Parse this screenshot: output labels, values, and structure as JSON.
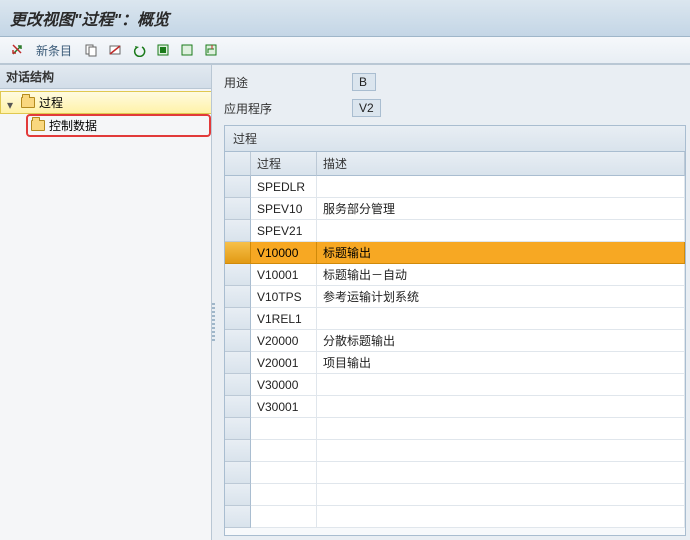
{
  "title": "更改视图\"过程\"：概览",
  "toolbar": {
    "new_entries": "新条目"
  },
  "sidebar": {
    "header": "对话结构",
    "items": [
      {
        "label": "过程",
        "children": [
          {
            "label": "控制数据"
          }
        ]
      }
    ]
  },
  "form": {
    "usage_label": "用途",
    "usage_value": "B",
    "application_label": "应用程序",
    "application_value": "V2"
  },
  "grid": {
    "title": "过程",
    "columns": [
      "过程",
      "描述"
    ],
    "selected_index": 3,
    "empty_rows": 5,
    "rows": [
      {
        "code": "SPEDLR",
        "desc": ""
      },
      {
        "code": "SPEV10",
        "desc": "服务部分管理"
      },
      {
        "code": "SPEV21",
        "desc": ""
      },
      {
        "code": "V10000",
        "desc": "标题输出"
      },
      {
        "code": "V10001",
        "desc": "标题输出－自动"
      },
      {
        "code": "V10TPS",
        "desc": "参考运输计划系统"
      },
      {
        "code": "V1REL1",
        "desc": ""
      },
      {
        "code": "V20000",
        "desc": "分散标题输出"
      },
      {
        "code": "V20001",
        "desc": "项目输出"
      },
      {
        "code": "V30000",
        "desc": ""
      },
      {
        "code": "V30001",
        "desc": ""
      }
    ]
  }
}
